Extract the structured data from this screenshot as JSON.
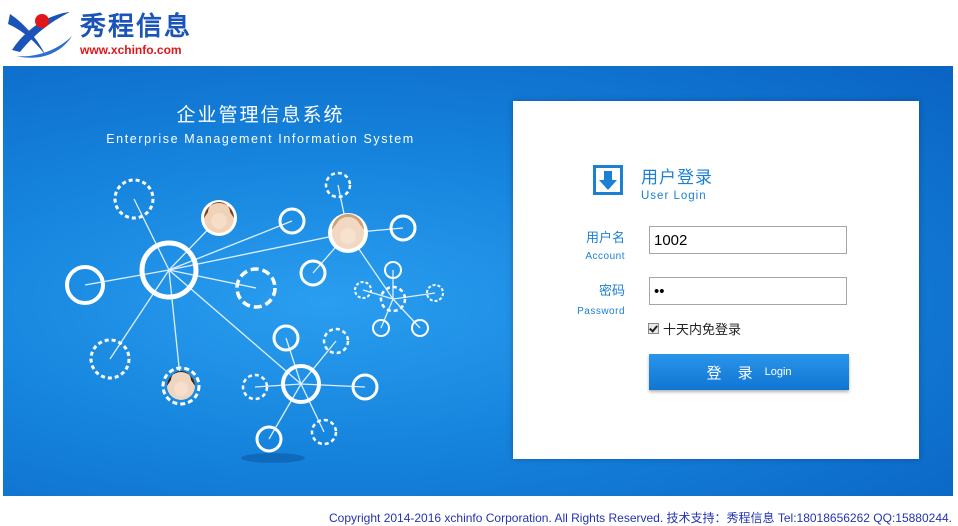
{
  "header": {
    "logo_text": "秀程信息",
    "logo_url": "www.xchinfo.com",
    "logo_mark_icon": "orbit-logo-icon",
    "brand_blue": "#1b54b8",
    "brand_red": "#e0161a"
  },
  "banner": {
    "title": "企业管理信息系统",
    "subtitle": "Enterprise Management Information System",
    "illustration_icon": "network-graph-illustration",
    "background": "#1583dc"
  },
  "login": {
    "icon": "download-arrow-icon",
    "title": "用户登录",
    "title_en": "User Login",
    "account_label": "用户名",
    "account_label_en": "Account",
    "account_value": "1002",
    "password_label": "密码",
    "password_label_en": "Password",
    "password_value": "••",
    "remember_label": "十天内免登录",
    "remember_checked": true,
    "button_label": "登 录",
    "button_label_en": "Login",
    "accent": "#1b7fd4"
  },
  "footer": {
    "copyright": "Copyright 2014-2016 xchinfo Corporation. All Rights Reserved. 技术支持：秀程信息 Tel:18018656262 QQ:15880244."
  }
}
